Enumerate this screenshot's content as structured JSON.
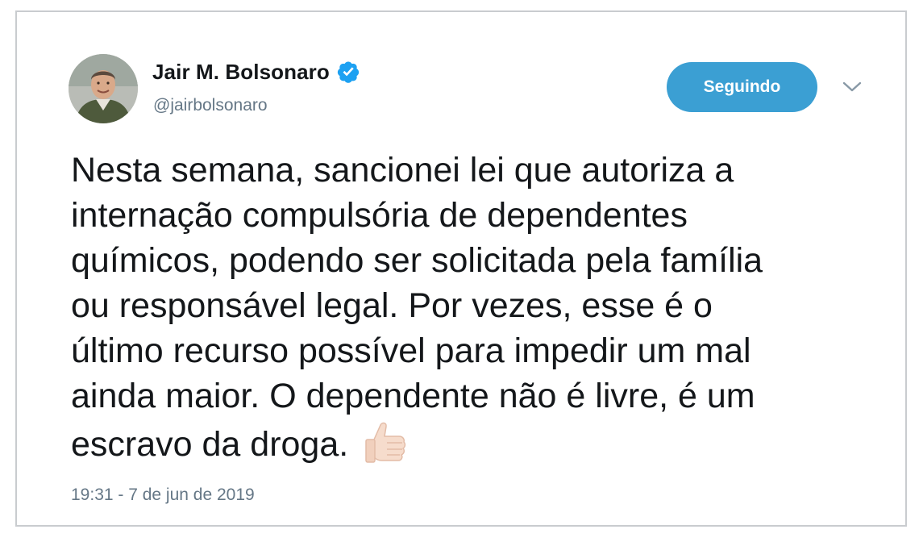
{
  "tweet": {
    "author": {
      "name": "Jair M. Bolsonaro",
      "handle": "@jairbolsonaro",
      "verified": true,
      "avatar_icon": "profile-photo"
    },
    "follow_button": {
      "label": "Seguindo",
      "color": "#3b9fd3"
    },
    "menu_icon": "chevron-down-icon",
    "text_lines": [
      "Nesta semana, sancionei lei que autoriza a",
      "internação compulsória de dependentes",
      "químicos, podendo ser solicitada pela família",
      "ou responsável legal. Por vezes, esse é o",
      "último recurso possível para impedir um mal",
      "ainda maior. O dependente não é livre, é um",
      "escravo da droga."
    ],
    "emoji": "thumbs-up",
    "timestamp": "19:31 - 7 de jun de 2019"
  },
  "colors": {
    "verified_badge": "#1da1f2",
    "secondary_text": "#657786",
    "primary_text": "#14171a",
    "border": "#c9cccf"
  }
}
